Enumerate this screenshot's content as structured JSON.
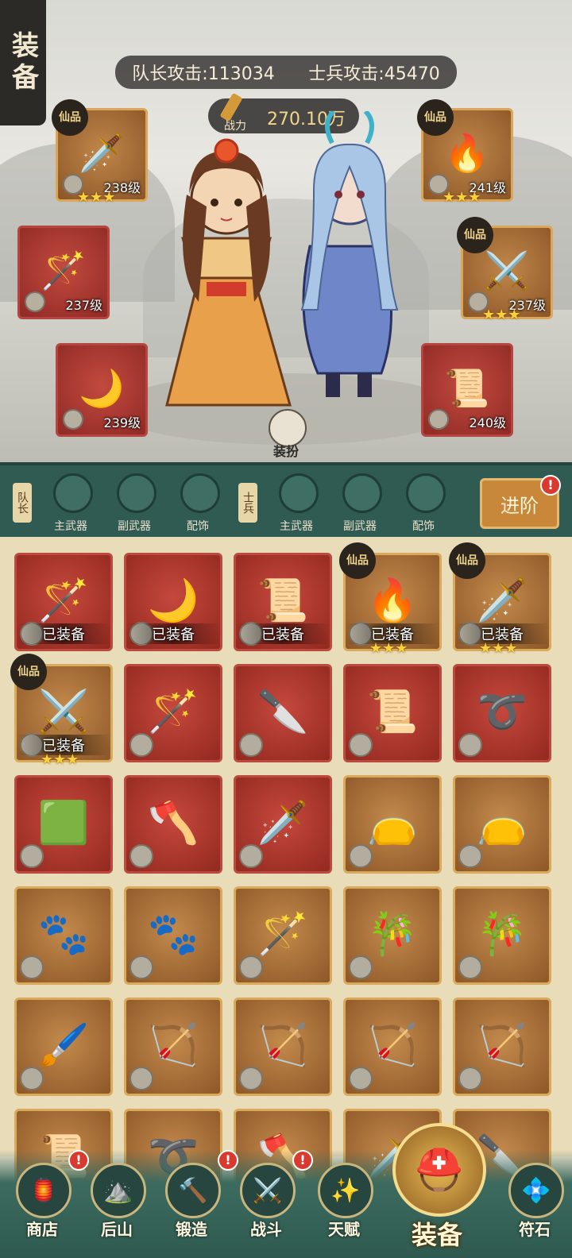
{
  "header": {
    "title": "装备",
    "captain_attack": "队长攻击:113034",
    "soldier_attack": "士兵攻击:45470",
    "power_label": "战力",
    "power_value": "270.10万",
    "dress_label": "装扮"
  },
  "slots": {
    "left_top": {
      "level": "238级",
      "rank": "仙品",
      "stars": "★★★",
      "icon": "green-serpent-blade"
    },
    "left_mid": {
      "level": "237级",
      "icon": "gourd-staff"
    },
    "left_bottom": {
      "level": "239级",
      "icon": "crescent-blade"
    },
    "right_top": {
      "level": "241级",
      "rank": "仙品",
      "stars": "★★★",
      "icon": "flame-blade"
    },
    "right_mid": {
      "level": "237级",
      "rank": "仙品",
      "stars": "★★★",
      "icon": "spirit-sword"
    },
    "right_bottom": {
      "level": "240级",
      "icon": "talisman-scroll"
    }
  },
  "categories": {
    "captain_tag": "队长",
    "soldier_tag": "士兵",
    "items": [
      "主武器",
      "副武器",
      "配饰",
      "主武器",
      "副武器",
      "配饰"
    ],
    "advance_label": "进阶",
    "advance_badge": "!"
  },
  "inventory": {
    "equipped_label": "已装备",
    "rank_label": "仙品",
    "stars": "★★★",
    "rows": [
      [
        {
          "icon": "gourd-staff",
          "bg": "red",
          "equipped": true
        },
        {
          "icon": "crescent-blade",
          "bg": "red",
          "equipped": true
        },
        {
          "icon": "talisman-scroll",
          "bg": "red",
          "equipped": true
        },
        {
          "icon": "flame-blade",
          "bg": "gold",
          "equipped": true,
          "rank": true,
          "starred": true
        },
        {
          "icon": "green-serpent-blade",
          "bg": "gold",
          "equipped": true,
          "rank": true,
          "starred": true
        }
      ],
      [
        {
          "icon": "spirit-sword",
          "bg": "gold",
          "equipped": true,
          "rank": true,
          "starred": true
        },
        {
          "icon": "gourd-staff",
          "bg": "red"
        },
        {
          "icon": "golden-dagger",
          "bg": "red"
        },
        {
          "icon": "talisman-scroll",
          "bg": "red"
        },
        {
          "icon": "red-whip",
          "bg": "red"
        }
      ],
      [
        {
          "icon": "jade-pendant",
          "bg": "red"
        },
        {
          "icon": "skull-axe",
          "bg": "red"
        },
        {
          "icon": "broad-saber",
          "bg": "red"
        },
        {
          "icon": "yinyang-pouch",
          "bg": "gold"
        },
        {
          "icon": "yinyang-pouch",
          "bg": "gold"
        }
      ],
      [
        {
          "icon": "beast-claw",
          "bg": "gold"
        },
        {
          "icon": "beast-claw",
          "bg": "gold"
        },
        {
          "icon": "gourd-staff",
          "bg": "gold"
        },
        {
          "icon": "bone-flute",
          "bg": "gold"
        },
        {
          "icon": "bone-flute",
          "bg": "gold"
        }
      ],
      [
        {
          "icon": "feather-brush",
          "bg": "gold"
        },
        {
          "icon": "crystal-bow",
          "bg": "gold"
        },
        {
          "icon": "crystal-bow",
          "bg": "gold"
        },
        {
          "icon": "crystal-bow",
          "bg": "gold"
        },
        {
          "icon": "crystal-bow",
          "bg": "gold"
        }
      ],
      [
        {
          "icon": "talisman-scroll",
          "bg": "gold"
        },
        {
          "icon": "red-whip",
          "bg": "gold"
        },
        {
          "icon": "skull-axe",
          "bg": "gold"
        },
        {
          "icon": "broad-saber",
          "bg": "gold"
        },
        {
          "icon": "golden-dagger",
          "bg": "gold"
        }
      ]
    ]
  },
  "nav": {
    "items": [
      {
        "label": "商店",
        "icon": "shop-icon",
        "badge": "!"
      },
      {
        "label": "后山",
        "icon": "mountain-portal-icon"
      },
      {
        "label": "锻造",
        "icon": "anvil-hammer-icon",
        "badge": "!"
      },
      {
        "label": "战斗",
        "icon": "battle-icon",
        "badge": "!"
      },
      {
        "label": "天赋",
        "icon": "constellation-icon"
      },
      {
        "label": "装备",
        "icon": "helmet-icon",
        "active": true
      },
      {
        "label": "符石",
        "icon": "rune-stone-icon"
      }
    ]
  },
  "colors": {
    "panel_green": "#2f5b52",
    "slot_red": "#c24a3f",
    "slot_gold": "#c0874a",
    "accent_gold": "#f1d58a",
    "badge_red": "#d93a2f"
  }
}
